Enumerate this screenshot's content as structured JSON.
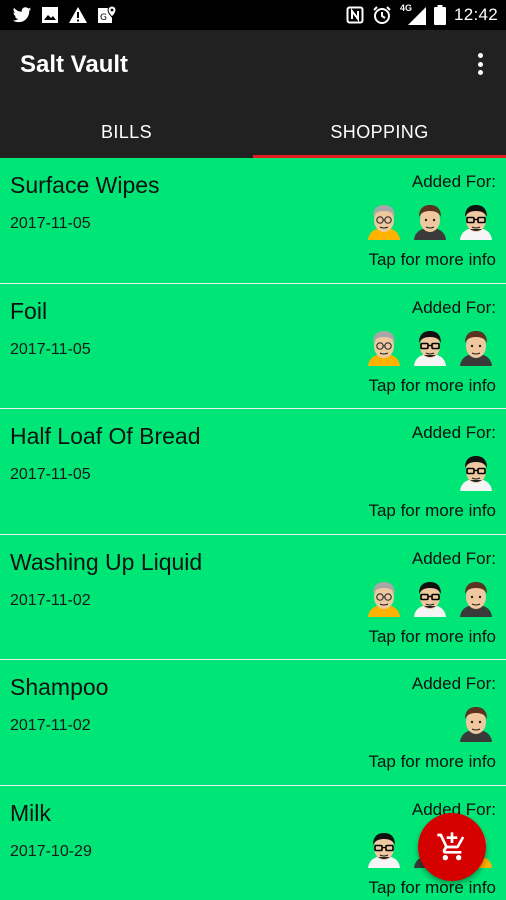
{
  "status_bar": {
    "time": "12:42",
    "network": "4G",
    "left_icons": [
      "twitter-icon",
      "image-icon",
      "warning-icon",
      "maps-icon"
    ],
    "right_icons": [
      "nfc-icon",
      "alarm-icon",
      "signal-icon",
      "battery-icon"
    ]
  },
  "app_bar": {
    "title": "Salt Vault",
    "tabs": [
      {
        "label": "BILLS",
        "selected": false
      },
      {
        "label": "SHOPPING",
        "selected": true
      }
    ],
    "accent_color": "#e51c23"
  },
  "list": {
    "item_color": "#00e676",
    "items": [
      {
        "name": "Surface Wipes",
        "date": "2017-11-05",
        "added_label": "Added For:",
        "avatars": [
          "elder",
          "brown",
          "glasses"
        ],
        "more_info": "Tap for more info"
      },
      {
        "name": "Foil",
        "date": "2017-11-05",
        "added_label": "Added For:",
        "avatars": [
          "elder",
          "glasses",
          "brown"
        ],
        "more_info": "Tap for more info"
      },
      {
        "name": "Half Loaf Of Bread",
        "date": "2017-11-05",
        "added_label": "Added For:",
        "avatars": [
          "glasses"
        ],
        "more_info": "Tap for more info"
      },
      {
        "name": "Washing Up Liquid",
        "date": "2017-11-02",
        "added_label": "Added For:",
        "avatars": [
          "elder",
          "glasses",
          "brown"
        ],
        "more_info": "Tap for more info"
      },
      {
        "name": "Shampoo",
        "date": "2017-11-02",
        "added_label": "Added For:",
        "avatars": [
          "brown"
        ],
        "more_info": "Tap for more info"
      },
      {
        "name": "Milk",
        "date": "2017-10-29",
        "added_label": "Added For:",
        "avatars": [
          "glasses",
          "brown",
          "elder"
        ],
        "more_info": "Tap for more info"
      }
    ]
  },
  "fab": {
    "icon": "add-to-cart-icon",
    "color": "#d50000"
  }
}
